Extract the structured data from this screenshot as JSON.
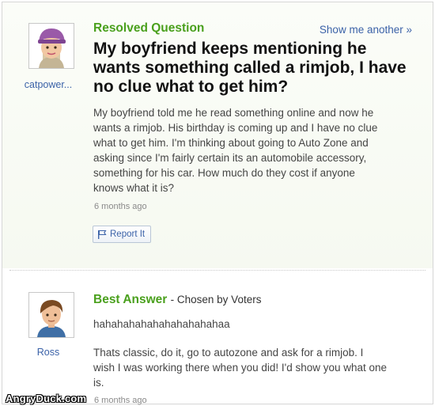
{
  "question": {
    "status_label": "Resolved Question",
    "show_another": "Show me another »",
    "title": "My boyfriend keeps mentioning he wants something called a rimjob, I have no clue what to get him?",
    "username": "catpower...",
    "body_lines": [
      "My boyfriend told me he read something online and now he",
      "wants a rimjob. His birthday is coming up and I have no clue",
      "what to get him. I'm thinking about going to Auto Zone and",
      "asking since I'm fairly certain its an automobile accessory,",
      "something for his car. How much do they cost if anyone",
      "knows what it is?"
    ],
    "timestamp": "6 months ago",
    "report_label": "Report It"
  },
  "answer": {
    "label": "Best Answer",
    "chosen_by": "- Chosen by Voters",
    "username": "Ross",
    "laugh": "hahahahahahahahahahahaa",
    "body_lines": [
      "Thats classic, do it, go to autozone and ask for a rimjob. I",
      "wish I was working there when you did! I'd show you what one",
      "is."
    ],
    "timestamp": "6 months ago"
  },
  "watermark": "AngryDuck.com",
  "colors": {
    "accent_green": "#4aa01d",
    "link_blue": "#3b62a8",
    "title_black": "#111111",
    "body_gray": "#454545",
    "timestamp_gray": "#8a8a8a"
  },
  "icons": {
    "question_avatar": "avatar-purple-hat-girl",
    "answer_avatar": "avatar-brown-hair-boy",
    "report": "flag-icon"
  }
}
